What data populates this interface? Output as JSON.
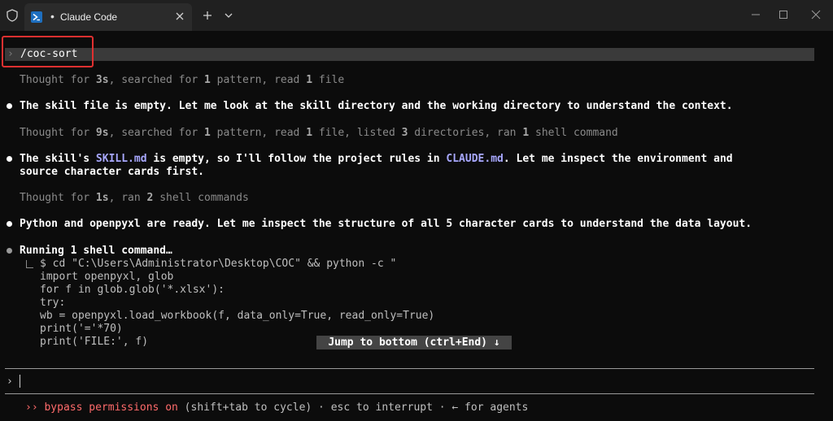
{
  "window": {
    "tab_title": "Claude Code",
    "tab_dot": "•"
  },
  "command": {
    "prompt": "›",
    "text": "/coc-sort"
  },
  "transcript": {
    "t1_pre": "Thought for ",
    "t1_time": "3s",
    "t1_mid1": ", searched for ",
    "t1_n1": "1",
    "t1_mid2": " pattern, read ",
    "t1_n2": "1",
    "t1_end": " file",
    "m1": "The skill file is empty. Let me look at the skill directory and the working directory to understand the context.",
    "t2_pre": "Thought for ",
    "t2_time": "9s",
    "t2_a": ", searched for ",
    "t2_n1": "1",
    "t2_b": " pattern, read ",
    "t2_n2": "1",
    "t2_c": " file, listed ",
    "t2_n3": "3",
    "t2_d": " directories, ran ",
    "t2_n4": "1",
    "t2_e": " shell command",
    "m2_a": "The skill's ",
    "m2_link1": "SKILL.md",
    "m2_b": " is empty, so I'll follow the project rules in ",
    "m2_link2": "CLAUDE.md",
    "m2_c": ". Let me inspect the environment and",
    "m2_line2": "source character cards first.",
    "t3_pre": "Thought for ",
    "t3_time": "1s",
    "t3_a": ", ran ",
    "t3_n1": "2",
    "t3_b": " shell commands",
    "m3": "Python and openpyxl are ready. Let me inspect the structure of all 5 character cards to understand the data layout.",
    "running": "Running 1 shell command…",
    "code": [
      "$ cd \"C:\\Users\\Administrator\\Desktop\\COC\" && python -c \"",
      "import openpyxl, glob",
      "for f in glob.glob('*.xlsx'):",
      "try:",
      "wb = openpyxl.load_workbook(f, data_only=True, read_only=True)",
      "print('='*70)",
      "print('FILE:', f)"
    ],
    "jump": "Jump to bottom (ctrl+End) ↓"
  },
  "input": {
    "prompt": "›"
  },
  "status": {
    "chevrons": "››",
    "mode": "bypass permissions on",
    "hint": " (shift+tab to cycle) · esc to interrupt · ← for agents"
  },
  "colors": {
    "background": "#0c0c0c",
    "link": "#a8a8ff",
    "warning": "#ff6b6b",
    "highlight_box": "#e03030"
  }
}
